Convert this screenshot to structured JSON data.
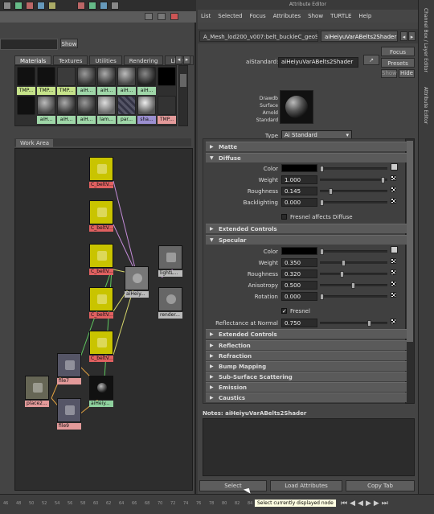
{
  "top_strip": {
    "icons": [
      "toolbar-icon"
    ]
  },
  "hypershade": {
    "show_button": "Show",
    "tabs": [
      {
        "label": "Materials",
        "active": true
      },
      {
        "label": "Textures",
        "active": false
      },
      {
        "label": "Utilities",
        "active": false
      },
      {
        "label": "Rendering",
        "active": false
      },
      {
        "label": "Lights",
        "active": false
      }
    ],
    "swatches_row1": [
      "TMP...",
      "TMP...",
      "TMP...",
      "aiH...",
      "aiH...",
      "aiH...",
      "aiH...",
      ""
    ],
    "swatches_row2": [
      "",
      "aiH...",
      "aiH...",
      "aiH...",
      "lam...",
      "par...",
      "sha...",
      "TMP..."
    ],
    "work_area_tab": "Work Area",
    "nodes": {
      "c1": "C_beltV...",
      "c2": "C_beltV...",
      "c3": "C_beltV...",
      "c4": "C_beltV...",
      "c5": "C_beltV...",
      "shader": "aiHeiy...",
      "lights": "lightL...",
      "render": "render...",
      "file7": "file7",
      "file9": "file9",
      "place2": "place2...",
      "aiheiy2": "aiHeiy..."
    }
  },
  "attribute_editor": {
    "window_title": "Attribute Editor",
    "menu": [
      "List",
      "Selected",
      "Focus",
      "Attributes",
      "Show",
      "TURTLE",
      "Help"
    ],
    "node_tab_left": "A_Mesh_lod200_v007:belt_buckleC_geoShape",
    "node_tab_right": "aiHeiyuVarABelts2Shader",
    "astandard_label": "aiStandard:",
    "astandard_value": "aiHeiyuVarABelts2Shader",
    "focus_btn": "Focus",
    "presets_btn": "Presets",
    "show_btn": "Show",
    "hide_btn": "Hide",
    "preview_caption": [
      "Drawdb",
      "Surface",
      "Arnold",
      "Standard"
    ],
    "type_label": "Type",
    "type_value": "Ai Standard",
    "sections": {
      "matte": "Matte",
      "diffuse": "Diffuse",
      "extended1": "Extended Controls",
      "specular": "Specular",
      "extended2": "Extended Controls",
      "reflection": "Reflection",
      "refraction": "Refraction",
      "bump": "Bump Mapping",
      "sss": "Sub-Surface Scattering",
      "emission": "Emission",
      "caustics": "Caustics"
    },
    "diffuse": {
      "color_label": "Color",
      "weight_label": "Weight",
      "weight": "1.000",
      "weight_level": 0.98,
      "roughness_label": "Roughness",
      "roughness": "0.145",
      "roughness_level": 0.14,
      "backlighting_label": "Backlighting",
      "backlighting": "0.000",
      "backlighting_level": 0.0,
      "fresnel_diffuse": "Fresnel affects Diffuse"
    },
    "specular": {
      "color_label": "Color",
      "weight_label": "Weight",
      "weight": "0.350",
      "weight_level": 0.35,
      "roughness_label": "Roughness",
      "roughness": "0.320",
      "roughness_level": 0.32,
      "anisotropy_label": "Anisotropy",
      "anisotropy": "0.500",
      "anisotropy_level": 0.5,
      "rotation_label": "Rotation",
      "rotation": "0.000",
      "rotation_level": 0.0,
      "fresnel": "Fresnel",
      "reflectance_label": "Reflectance at Normal",
      "reflectance": "0.750",
      "reflectance_level": 0.75
    },
    "notes_label": "Notes:  aiHeiyuVarABelts2Shader",
    "buttons": {
      "select": "Select",
      "load": "Load Attributes",
      "copy": "Copy Tab"
    }
  },
  "side_panel": {
    "channel_box": "Channel Box / Layer Editor",
    "attr_editor": "Attribute Editor"
  },
  "timeline": {
    "ticks": [
      "46",
      "48",
      "50",
      "52",
      "54",
      "56",
      "58",
      "60",
      "62",
      "64",
      "66",
      "68",
      "70",
      "72",
      "74",
      "76",
      "78",
      "80",
      "82",
      "84",
      "86",
      "88",
      "90",
      "92",
      "94",
      "96"
    ]
  },
  "tooltip": "Select currently displayed node",
  "colors": {
    "yellow_node": "#c9c400",
    "green_label": "#8fd19e",
    "red_label": "#e39a9a"
  }
}
